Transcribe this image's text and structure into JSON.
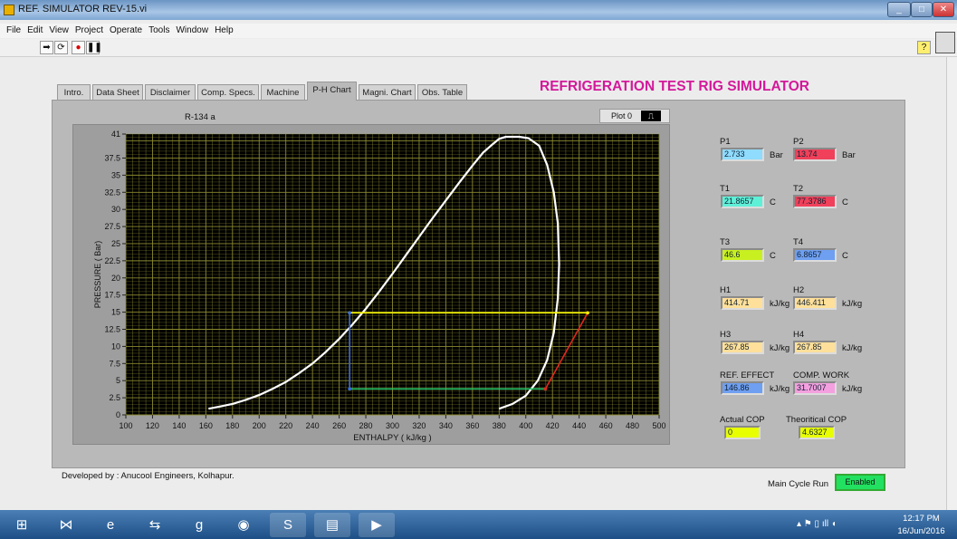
{
  "window": {
    "title": "REF. SIMULATOR REV-15.vi"
  },
  "menu": [
    "File",
    "Edit",
    "View",
    "Project",
    "Operate",
    "Tools",
    "Window",
    "Help"
  ],
  "tabs": [
    "Intro.",
    "Data Sheet",
    "Disclaimer",
    "Comp. Specs.",
    "Machine",
    "P-H Chart",
    "Magni. Chart",
    "Obs. Table"
  ],
  "active_tab": "P-H Chart",
  "app_title": "REFRIGERATION TEST RIG SIMULATOR",
  "app_title_color": "#d3199a",
  "graph": {
    "refrigerant": "R-134 a",
    "legend_label": "Plot 0"
  },
  "chart_data": {
    "type": "line",
    "xlabel": "ENTHALPY ( kJ/kg )",
    "ylabel": "PRESSURE ( Bar)",
    "xlim": [
      100,
      500
    ],
    "ylim": [
      0,
      41
    ],
    "xticks": [
      100,
      120,
      140,
      160,
      180,
      200,
      220,
      240,
      260,
      280,
      300,
      320,
      340,
      360,
      380,
      400,
      420,
      440,
      460,
      480,
      500
    ],
    "yticks": [
      0,
      2.5,
      5,
      7.5,
      10,
      12.5,
      15,
      17.5,
      20,
      22.5,
      25,
      27.5,
      30,
      32.5,
      35,
      37.5,
      41
    ],
    "grid": true,
    "background": "#000000",
    "grid_color": "#8a8a30",
    "series": [
      {
        "color": "#ffffff",
        "points": [
          [
            162,
            0.9
          ],
          [
            170,
            1.2
          ],
          [
            180,
            1.6
          ],
          [
            190,
            2.2
          ],
          [
            200,
            2.9
          ],
          [
            210,
            3.8
          ],
          [
            220,
            4.8
          ],
          [
            230,
            6.1
          ],
          [
            240,
            7.5
          ],
          [
            250,
            9.2
          ],
          [
            260,
            11.1
          ],
          [
            270,
            13.2
          ],
          [
            280,
            15.5
          ],
          [
            290,
            18.0
          ],
          [
            300,
            20.6
          ],
          [
            310,
            23.3
          ],
          [
            320,
            26.0
          ],
          [
            330,
            28.7
          ],
          [
            340,
            31.3
          ],
          [
            350,
            33.9
          ],
          [
            360,
            36.4
          ],
          [
            368,
            38.3
          ],
          [
            375,
            39.5
          ],
          [
            380,
            40.3
          ],
          [
            385,
            40.6
          ],
          [
            395,
            40.6
          ],
          [
            402,
            40.4
          ],
          [
            410,
            39.3
          ],
          [
            416,
            36.5
          ],
          [
            421,
            32.5
          ],
          [
            424,
            28
          ],
          [
            425,
            22
          ],
          [
            424,
            17
          ],
          [
            421,
            12
          ],
          [
            416,
            8
          ],
          [
            409,
            5
          ],
          [
            400,
            2.8
          ],
          [
            390,
            1.6
          ],
          [
            380,
            0.9
          ]
        ]
      },
      {
        "color": "#2ec76a",
        "points": [
          [
            267.85,
            3.8
          ],
          [
            414.71,
            3.8
          ]
        ]
      },
      {
        "color": "#e0281e",
        "points": [
          [
            414.71,
            3.8
          ],
          [
            446.41,
            14.9
          ]
        ]
      },
      {
        "color": "#f2f200",
        "points": [
          [
            446.41,
            14.9
          ],
          [
            267.85,
            14.9
          ]
        ]
      },
      {
        "color": "#3a6be0",
        "points": [
          [
            267.85,
            14.9
          ],
          [
            267.85,
            3.8
          ]
        ]
      }
    ]
  },
  "readings": [
    {
      "label": "P1",
      "value": "2.733",
      "unit": "Bar",
      "color": "#8fdcff"
    },
    {
      "label": "P2",
      "value": "13.74",
      "unit": "Bar",
      "color": "#f0405a"
    },
    {
      "label": "T1",
      "value": "21.8657",
      "unit": "C",
      "color": "#5ff0d8"
    },
    {
      "label": "T2",
      "value": "77.3786",
      "unit": "C",
      "color": "#f0405a"
    },
    {
      "label": "T3",
      "value": "46.6",
      "unit": "C",
      "color": "#c8f020"
    },
    {
      "label": "T4",
      "value": "6.8657",
      "unit": "C",
      "color": "#6f9ff0"
    },
    {
      "label": "H1",
      "value": "414.71",
      "unit": "kJ/kg",
      "color": "#ffe09a"
    },
    {
      "label": "H2",
      "value": "446.411",
      "unit": "kJ/kg",
      "color": "#ffe09a"
    },
    {
      "label": "H3",
      "value": "267.85",
      "unit": "kJ/kg",
      "color": "#ffe09a"
    },
    {
      "label": "H4",
      "value": "267.85",
      "unit": "kJ/kg",
      "color": "#ffe09a"
    },
    {
      "label": "REF. EFFECT",
      "value": "146.86",
      "unit": "kJ/kg",
      "color": "#6f9ff0"
    },
    {
      "label": "COMP. WORK",
      "value": "31.7007",
      "unit": "kJ/kg",
      "color": "#f4a0e0"
    },
    {
      "label": "Actual COP",
      "value": "0",
      "unit": "",
      "color": "#e8ff00"
    },
    {
      "label": "Theoritical COP",
      "value": "4.6327",
      "unit": "",
      "color": "#e8ff00"
    }
  ],
  "footer": {
    "developer": "Developed by : Anucool Engineers, Kolhapur.",
    "main_cycle_label": "Main Cycle Run",
    "main_cycle_state": "Enabled",
    "main_cycle_color": "#22e060"
  },
  "taskbar": {
    "time": "12:17 PM",
    "date": "16/Jun/2016",
    "apps": [
      "start",
      "visual-studio",
      "internet-explorer",
      "teamviewer",
      "google",
      "chrome",
      "skype",
      "file-explorer",
      "labview"
    ]
  }
}
